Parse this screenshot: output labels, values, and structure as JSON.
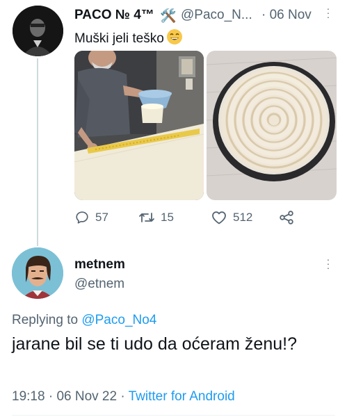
{
  "tweet": {
    "author_name": "PACO № 4™",
    "author_tools_emoji": "🛠️",
    "author_handle": "@Paco_N...",
    "date_sep": "·",
    "date": "06 Nov",
    "text": "Muški jeli teško",
    "emoji": "grinning-face-with-smiling-eyes",
    "stats": {
      "replies": "57",
      "retweets": "15",
      "likes": "512"
    },
    "media": [
      {
        "description_icon": "man-sprinkling-cheese-photo"
      },
      {
        "description_icon": "dough-spiral-in-pan-photo"
      }
    ]
  },
  "reply": {
    "author_name": "metnem",
    "author_handle": "@etnem",
    "replying_prefix": "Replying to",
    "replying_to": "@Paco_No4",
    "text": "jarane bil se ti udo da oćeram ženu!?",
    "time": "19:18",
    "date": "06 Nov 22",
    "meta_sep": "·",
    "client": "Twitter for Android"
  },
  "colors": {
    "link": "#1d9bf0",
    "muted": "#536471",
    "text": "#0f1419",
    "thread_line": "#cfd9de"
  }
}
